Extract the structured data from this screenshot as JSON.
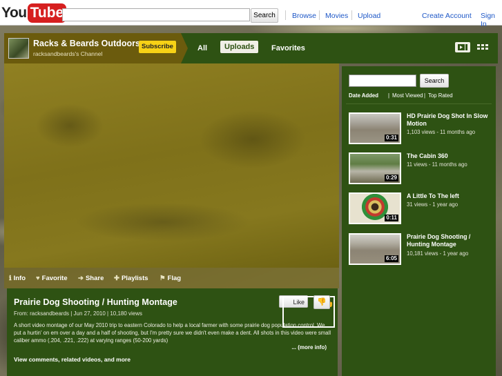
{
  "site": {
    "logo_you": "You",
    "logo_tube": "Tube",
    "search_button": "Search",
    "nav": [
      "Browse",
      "Movies",
      "Upload"
    ],
    "create_account": "Create Account",
    "sign_in": "Sign In"
  },
  "channel": {
    "name": "Racks & Beards Outdoors",
    "subtitle": "racksandbeards's Channel",
    "subscribe_label": "Subscribe",
    "tabs": [
      "All",
      "Uploads",
      "Favorites"
    ],
    "active_tab": "Uploads"
  },
  "player_actions": [
    {
      "icon": "info-icon",
      "glyph": "ℹ",
      "label": "Info"
    },
    {
      "icon": "heart-icon",
      "glyph": "♥",
      "label": "Favorite"
    },
    {
      "icon": "share-arrow-icon",
      "glyph": "➔",
      "label": "Share"
    },
    {
      "icon": "plus-icon",
      "glyph": "✚",
      "label": "Playlists"
    },
    {
      "icon": "flag-icon",
      "glyph": "⚑",
      "label": "Flag"
    }
  ],
  "video": {
    "title": "Prairie Dog Shooting / Hunting Montage",
    "meta": "From: racksandbeards  | Jun 27, 2010  | 10,180 views",
    "description": "A short video montage of our May 2010 trip to eastern Colorado to help a local farmer with some prairie dog population control. We put a hurtin' on em over a day and a half of shooting, but I'm pretty sure we didn't even make a dent. All shots in this video were small caliber ammo (.204, .221, .222) at varying ranges (50-200 yards)",
    "more_info": "... (more info)",
    "comments_link": "View comments, related videos, and more",
    "like_label": "Like"
  },
  "sidebar": {
    "search_button": "Search",
    "sort": {
      "date_added": "Date Added",
      "sep1": "|",
      "most_viewed": "Most Viewed",
      "sep2": "|",
      "top_rated": "Top Rated"
    },
    "videos": [
      {
        "title": "HD Prairie Dog Shot In Slow Motion",
        "meta": "1,103 views - 11 months ago",
        "duration": "0:31"
      },
      {
        "title": "The Cabin 360",
        "meta": "11 views - 11 months ago",
        "duration": "0:29"
      },
      {
        "title": "A Little To The left",
        "meta": "31 views - 1 year ago",
        "duration": "0:11"
      },
      {
        "title": "Prairie Dog Shooting / Hunting Montage",
        "meta": "10,181 views - 1 year ago",
        "duration": "6:05"
      }
    ]
  },
  "colors": {
    "header_green": "#2e5213",
    "channel_tab": "#6b5b0d",
    "subscribe_yellow": "#f7d216",
    "link_blue": "#1d57c7",
    "logo_red": "#d61f1f"
  }
}
